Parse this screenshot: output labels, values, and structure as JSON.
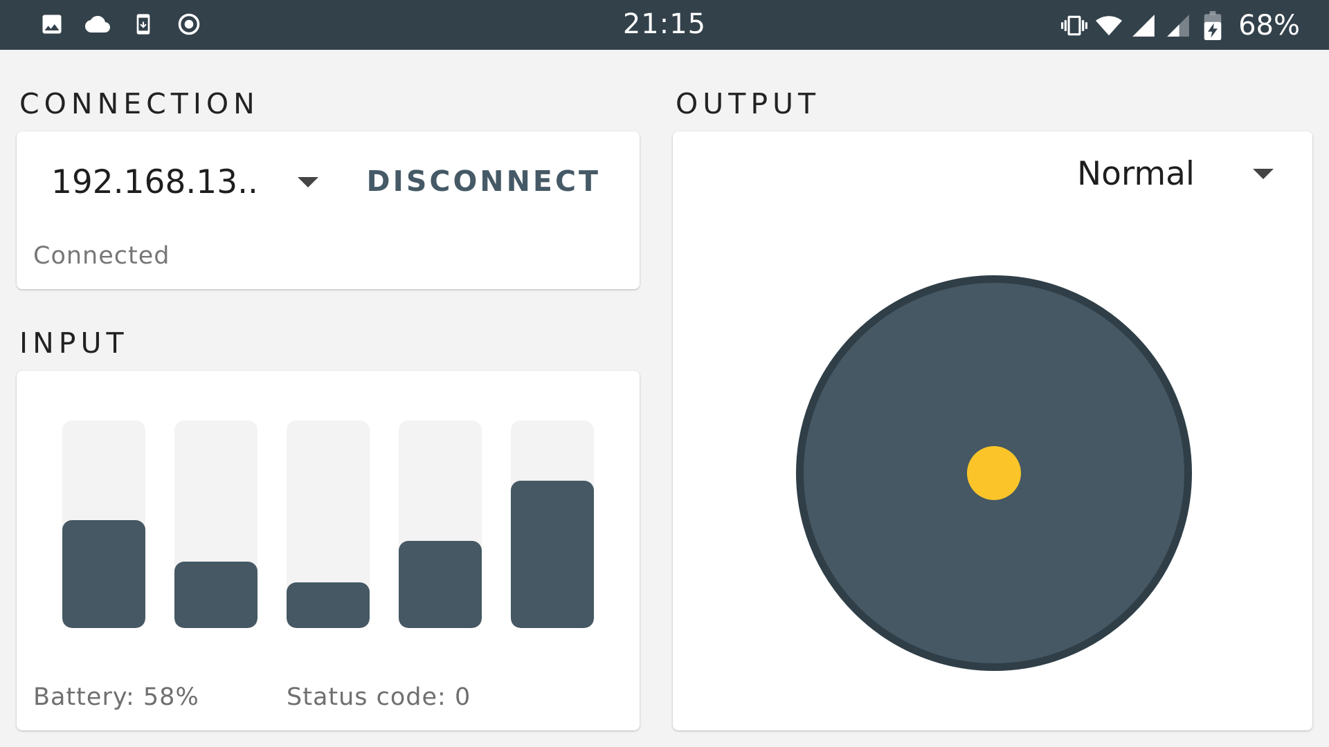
{
  "status_bar": {
    "time": "21:15",
    "battery": "68%",
    "left_icons": [
      "image-icon",
      "cloud-icon",
      "download-icon",
      "record-icon"
    ],
    "right_icons": [
      "vibrate-icon",
      "wifi-icon",
      "signal-icon",
      "signal-weak-icon",
      "battery-charging-icon"
    ]
  },
  "connection": {
    "title": "CONNECTION",
    "host": "192.168.13..",
    "disconnect_label": "DISCONNECT",
    "status": "Connected"
  },
  "input": {
    "title": "INPUT",
    "bars": [
      {
        "level": 0.52
      },
      {
        "level": 0.32
      },
      {
        "level": 0.22
      },
      {
        "level": 0.42
      },
      {
        "level": 0.71
      }
    ],
    "battery_text": "Battery: 58%",
    "status_code_text": "Status code: 0"
  },
  "output": {
    "title": "OUTPUT",
    "mode": "Normal",
    "knob_x": 0.0,
    "knob_y": 0.0
  },
  "colors": {
    "status_bar_bg": "#33414b",
    "accent": "#455864",
    "knob": "#fbc52a",
    "background": "#f3f3f3"
  }
}
